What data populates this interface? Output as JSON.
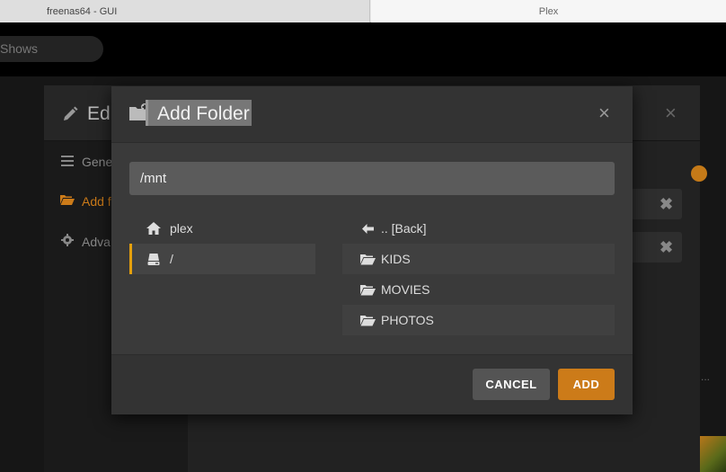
{
  "browser": {
    "tabs": [
      {
        "title": "freenas64 - GUI"
      },
      {
        "title": "Plex"
      }
    ]
  },
  "background": {
    "search_text": "Shows",
    "edit_modal": {
      "title": "Edi",
      "nav": [
        {
          "label": "Gene",
          "icon": "list-icon"
        },
        {
          "label": "Add f",
          "icon": "folder-open-icon",
          "active": true
        },
        {
          "label": "Adva",
          "icon": "gear-icon"
        }
      ],
      "close_symbol": "×",
      "field_remove_symbol": "✖",
      "more_symbol": "..."
    }
  },
  "add_folder_dialog": {
    "title": "Add Folder",
    "close_symbol": "×",
    "path_value": "/mnt",
    "left_items": [
      {
        "label": "plex",
        "icon": "home-icon",
        "selected": false
      },
      {
        "label": "/",
        "icon": "drive-icon",
        "selected": true
      }
    ],
    "right_items": [
      {
        "label": ".. [Back]",
        "icon": "arrow-left-icon"
      },
      {
        "label": "KIDS",
        "icon": "folder-open-icon"
      },
      {
        "label": "MOVIES",
        "icon": "folder-open-icon"
      },
      {
        "label": "PHOTOS",
        "icon": "folder-open-icon"
      }
    ],
    "buttons": {
      "cancel": "CANCEL",
      "add": "ADD"
    }
  },
  "colors": {
    "accent": "#cc7b19",
    "selection_bar": "#e5a00d",
    "dialog_bg": "#3a3a3a"
  }
}
